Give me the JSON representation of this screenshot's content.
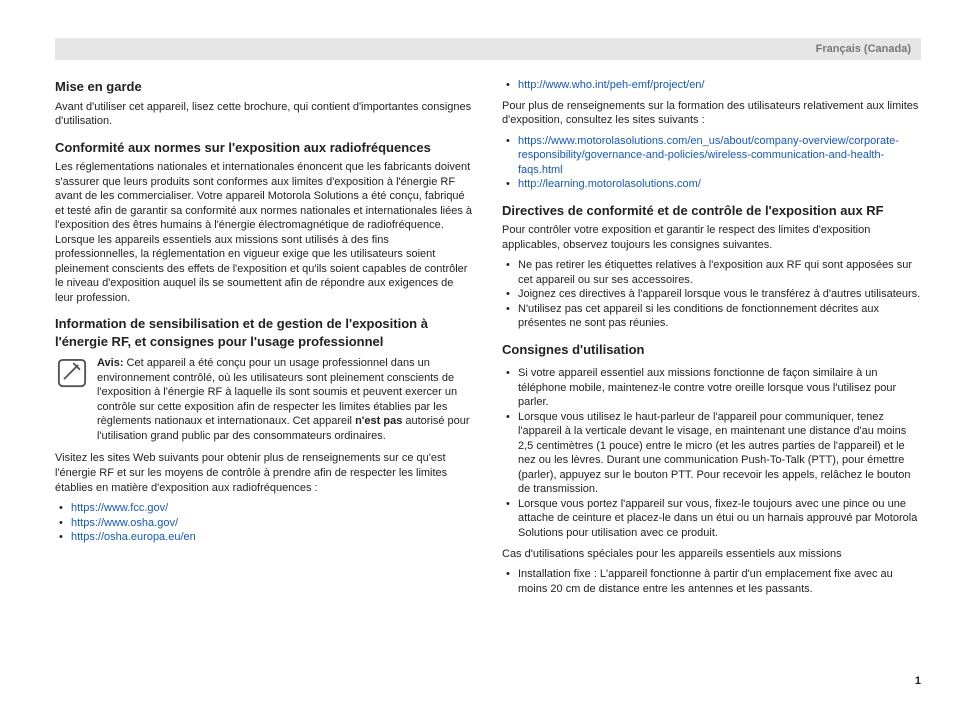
{
  "header": {
    "lang": "Français (Canada)"
  },
  "pageNumber": "1",
  "left": {
    "h_mise": "Mise en garde",
    "p_mise": "Avant d'utiliser cet appareil, lisez cette brochure, qui contient d'importantes consignes d'utilisation.",
    "h_conf": "Conformité aux normes sur l'exposition aux radiofréquences",
    "p_conf": "Les réglementations nationales et internationales énoncent que les fabricants doivent s'assurer que leurs produits sont conformes aux limites d'exposition à l'énergie RF avant de les commercialiser. Votre appareil Motorola Solutions a été conçu, fabriqué et testé afin de garantir sa conformité aux normes nationales et internationales liées à l'exposition des êtres humains à l'énergie électromagnétique de radiofréquence. Lorsque les appareils essentiels aux missions sont utilisés à des fins professionnelles, la réglementation en vigueur exige que les utilisateurs soient pleinement conscients des effets de l'exposition et qu'ils soient capables de contrôler le niveau d'exposition auquel ils se soumettent afin de répondre aux exigences de leur profession.",
    "h_info": "Information de sensibilisation et de gestion de l'exposition à l'énergie RF, et consignes pour l'usage professionnel",
    "avis_label": "Avis:",
    "avis_body1": " Cet appareil a été conçu pour un usage professionnel dans un environnement contrôlé, où les utilisateurs sont pleinement conscients de l'exposition à l'énergie RF à laquelle ils sont soumis et peuvent exercer un contrôle sur cette exposition afin de respecter les limites établies par les règlements nationaux et internationaux. Cet appareil ",
    "avis_bold": "n'est pas",
    "avis_body2": " autorisé pour l'utilisation grand public par des consommateurs ordinaires.",
    "p_visit": "Visitez les sites Web suivants pour obtenir plus de renseignements sur ce qu'est l'énergie RF et sur les moyens de contrôle à prendre afin de respecter les limites établies en matière d'exposition aux radiofréquences :",
    "links1": [
      "https://www.fcc.gov/",
      "https://www.osha.gov/",
      "https://osha.europa.eu/en"
    ]
  },
  "right": {
    "links2": [
      "http://www.who.int/peh-emf/project/en/"
    ],
    "p_more": "Pour plus de renseignements sur la formation des utilisateurs relativement aux limites d'exposition, consultez les sites suivants :",
    "links3": [
      "https://www.motorolasolutions.com/en_us/about/company-overview/corporate-responsibility/governance-and-policies/wireless-communication-and-health-faqs.html",
      "http://learning.motorolasolutions.com/"
    ],
    "h_dir": "Directives de conformité et de contrôle de l'exposition aux RF",
    "p_dir": "Pour contrôler votre exposition et garantir le respect des limites d'exposition applicables, observez toujours les consignes suivantes.",
    "dir_items": [
      "Ne pas retirer les étiquettes relatives à l'exposition aux RF qui sont apposées sur cet appareil ou sur ses accessoires.",
      "Joignez ces directives à l'appareil lorsque vous le transférez à d'autres utilisateurs.",
      "N'utilisez pas cet appareil si les conditions de fonctionnement décrites aux présentes ne sont pas réunies."
    ],
    "h_cons": "Consignes d'utilisation",
    "cons_items": [
      "Si votre appareil essentiel aux missions fonctionne de façon similaire à un téléphone mobile, maintenez-le contre votre oreille lorsque vous l'utilisez pour parler.",
      "Lorsque vous utilisez le haut-parleur de l'appareil pour communiquer, tenez l'appareil à la verticale devant le visage, en maintenant une distance d'au moins 2,5 centimètres (1 pouce) entre le micro (et les autres parties de l'appareil) et le nez ou les lèvres. Durant une communication Push-To-Talk (PTT), pour émettre (parler), appuyez sur le bouton PTT. Pour recevoir les appels, relâchez le bouton de transmission.",
      "Lorsque vous portez l'appareil sur vous, fixez-le toujours avec une pince ou une attache de ceinture et placez-le dans un étui ou un harnais approuvé par Motorola Solutions pour utilisation avec ce produit."
    ],
    "p_cas": "Cas d'utilisations spéciales pour les appareils essentiels aux missions",
    "cas_items": [
      "Installation fixe : L'appareil fonctionne à partir d'un emplacement fixe avec au moins 20 cm de distance entre les antennes et les passants."
    ]
  }
}
